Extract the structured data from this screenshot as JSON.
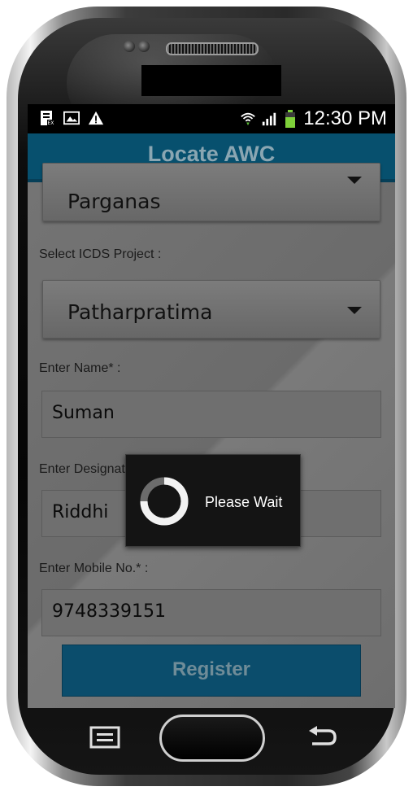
{
  "status_bar": {
    "time": "12:30 PM",
    "left_icons": [
      "data-icon",
      "image-icon",
      "warning-icon"
    ],
    "right_icons": [
      "wifi-icon",
      "signal-icon",
      "battery-icon"
    ]
  },
  "header": {
    "title": "Locate AWC"
  },
  "form": {
    "district_value": "Parganas",
    "project_label": "Select ICDS Project :",
    "project_value": "Patharpratima",
    "name_label": "Enter Name* :",
    "name_value": "Suman",
    "designation_label": "Enter Designation* :",
    "designation_value": "Riddhi",
    "mobile_label": "Enter Mobile No.* :",
    "mobile_value": "9748339151",
    "register_label": "Register"
  },
  "dialog": {
    "message": "Please Wait"
  },
  "colors": {
    "title_bar": "#07506e",
    "register_button": "#0b4d6c",
    "content_background": "#6e6e6e",
    "dialog_background": "#141414"
  },
  "nav_icons": [
    "menu-icon",
    "home-button",
    "back-icon"
  ]
}
